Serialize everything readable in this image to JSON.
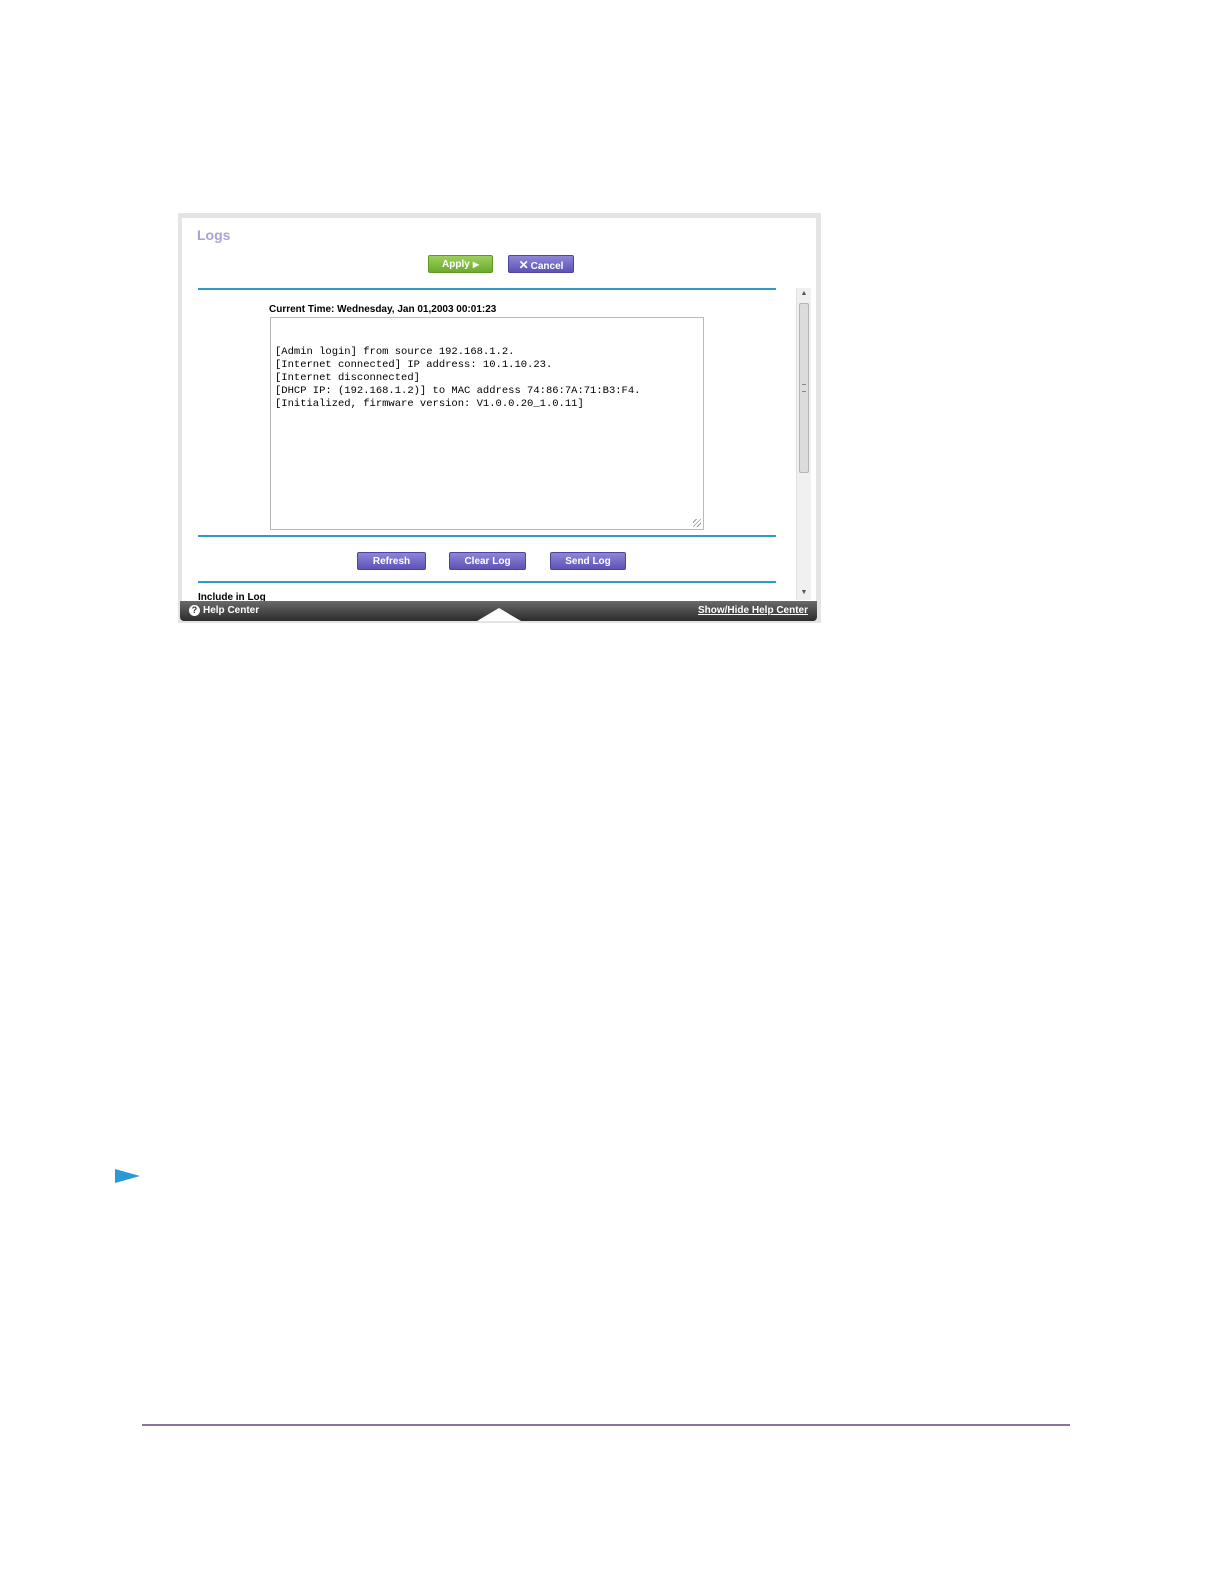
{
  "page": {
    "title": "Logs",
    "apply_label": "Apply",
    "cancel_label": "Cancel",
    "current_time": "Current Time: Wednesday, Jan 01,2003 00:01:23",
    "log_lines": [
      "[Admin login] from source 192.168.1.2.",
      "[Internet connected] IP address: 10.1.10.23.",
      "[Internet disconnected]",
      "[DHCP IP: (192.168.1.2)] to MAC address 74:86:7A:71:B3:F4.",
      "[Initialized, firmware version: V1.0.0.20_1.0.11]"
    ],
    "refresh_label": "Refresh",
    "clear_log_label": "Clear Log",
    "send_log_label": "Send Log",
    "include_in_log": "Include in Log"
  },
  "help_bar": {
    "help_center_label": "Help Center",
    "show_hide_label": "Show/Hide Help Center"
  },
  "colors": {
    "title": "#a9a2d4",
    "rule": "#2f9cc8",
    "apply": "#7fbc3c",
    "purple_button": "#6c62c4",
    "footer_rule": "#8b73a8",
    "marker": "#2a9ad6"
  }
}
